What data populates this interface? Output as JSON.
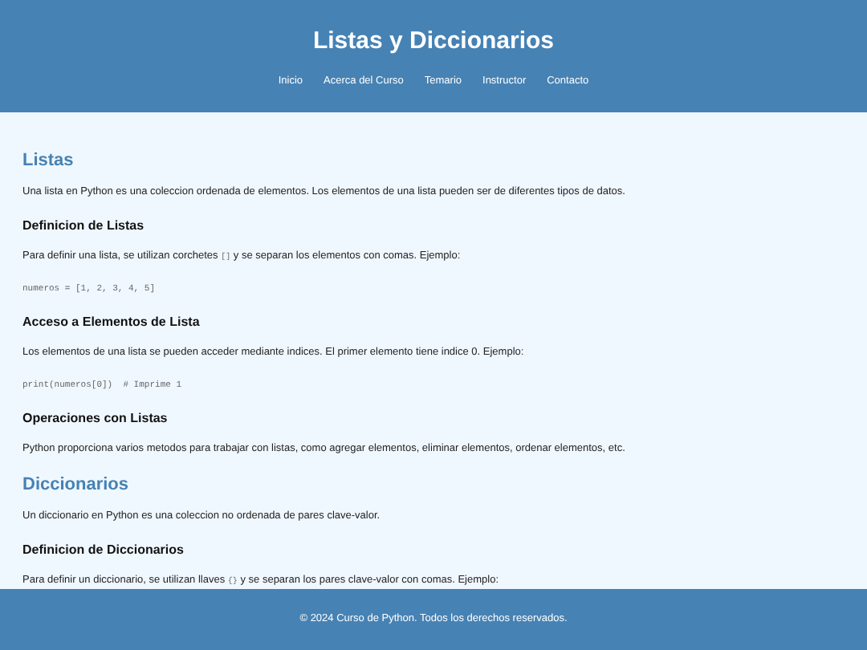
{
  "header": {
    "title": "Listas y Diccionarios",
    "nav": [
      "Inicio",
      "Acerca del Curso",
      "Temario",
      "Instructor",
      "Contacto"
    ]
  },
  "content": [
    {
      "kind": "h2",
      "text": "Listas"
    },
    {
      "kind": "p",
      "parts": [
        {
          "kind": "text",
          "text": "Una lista en Python es una coleccion ordenada de elementos. Los elementos de una lista pueden ser de diferentes tipos de datos."
        }
      ]
    },
    {
      "kind": "h3",
      "text": "Definicion de Listas"
    },
    {
      "kind": "p",
      "parts": [
        {
          "kind": "text",
          "text": "Para definir una lista, se utilizan corchetes "
        },
        {
          "kind": "code",
          "text": "[]"
        },
        {
          "kind": "text",
          "text": " y se separan los elementos con comas. Ejemplo:"
        }
      ]
    },
    {
      "kind": "code",
      "text": "numeros = [1, 2, 3, 4, 5]"
    },
    {
      "kind": "h3",
      "text": "Acceso a Elementos de Lista"
    },
    {
      "kind": "p",
      "parts": [
        {
          "kind": "text",
          "text": "Los elementos de una lista se pueden acceder mediante indices. El primer elemento tiene indice 0. Ejemplo:"
        }
      ]
    },
    {
      "kind": "code",
      "text": "print(numeros[0])  # Imprime 1"
    },
    {
      "kind": "h3",
      "text": "Operaciones con Listas"
    },
    {
      "kind": "p",
      "parts": [
        {
          "kind": "text",
          "text": "Python proporciona varios metodos para trabajar con listas, como agregar elementos, eliminar elementos, ordenar elementos, etc."
        }
      ]
    },
    {
      "kind": "h2",
      "text": "Diccionarios"
    },
    {
      "kind": "p",
      "parts": [
        {
          "kind": "text",
          "text": "Un diccionario en Python es una coleccion no ordenada de pares clave-valor."
        }
      ]
    },
    {
      "kind": "h3",
      "text": "Definicion de Diccionarios"
    },
    {
      "kind": "p",
      "parts": [
        {
          "kind": "text",
          "text": "Para definir un diccionario, se utilizan llaves "
        },
        {
          "kind": "code",
          "text": "{}"
        },
        {
          "kind": "text",
          "text": " y se separan los pares clave-valor con comas. Ejemplo:"
        }
      ]
    }
  ],
  "footer": {
    "text": "© 2024 Curso de Python. Todos los derechos reservados."
  }
}
